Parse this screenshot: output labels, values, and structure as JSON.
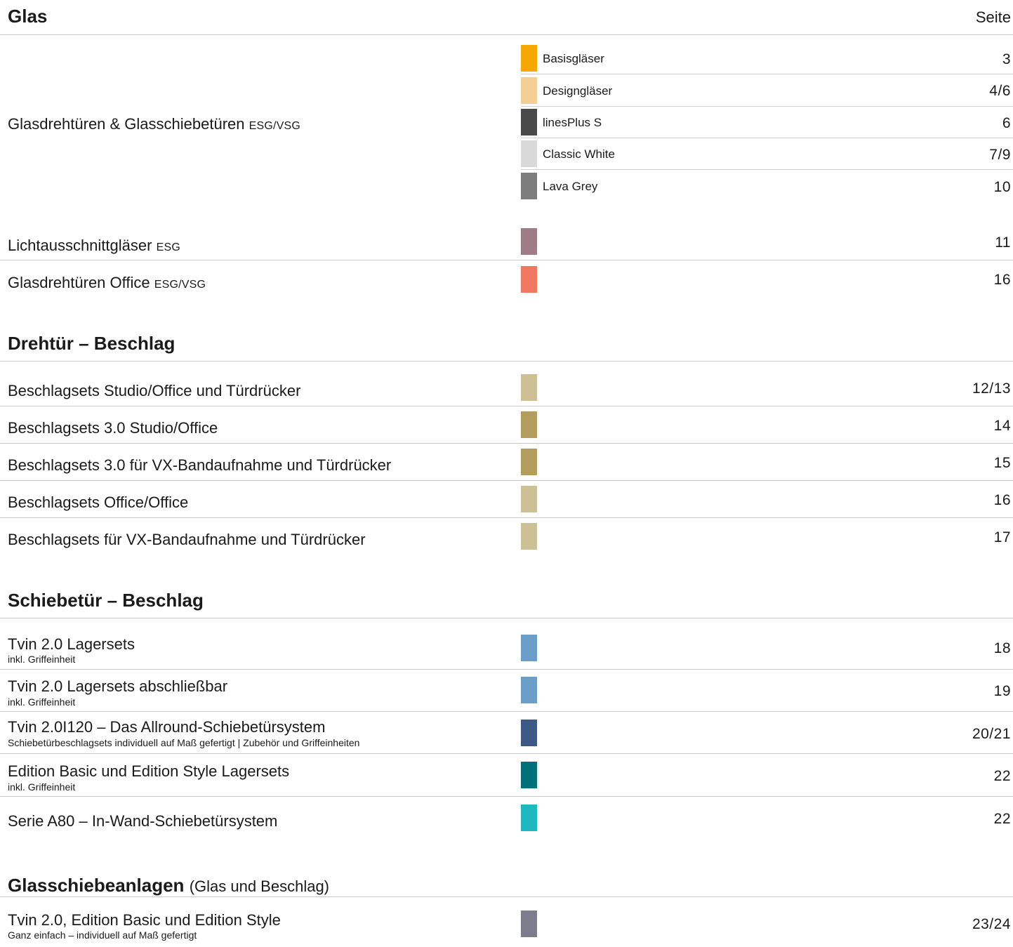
{
  "sections": [
    {
      "title": "Glas",
      "right_label": "Seite"
    },
    {
      "title": "Drehtür – Beschlag"
    },
    {
      "title": "Schiebetür – Beschlag"
    },
    {
      "title": "Glasschiebeanlagen",
      "note": "(Glas und Beschlag)"
    }
  ],
  "glas": {
    "group": {
      "title": "Glasdrehtüren & Glasschiebetüren",
      "suffix": "ESG/VSG",
      "items": [
        {
          "label": "Basisgläser",
          "page": "3",
          "color": "#f5a800"
        },
        {
          "label": "Designgläser",
          "page": "4/6",
          "color": "#f3cf96"
        },
        {
          "label": "linesPlus S",
          "page": "6",
          "color": "#4a4a4a"
        },
        {
          "label": "Classic White",
          "page": "7/9",
          "color": "#d9d9d9"
        },
        {
          "label": "Lava Grey",
          "page": "10",
          "color": "#7d7d7d"
        }
      ]
    },
    "rows": [
      {
        "title": "Lichtausschnittgläser",
        "suffix": "ESG",
        "page": "11",
        "color": "#9e7b85"
      },
      {
        "title": "Glasdrehtüren Office",
        "suffix": "ESG/VSG",
        "page": "16",
        "color": "#f07860"
      }
    ]
  },
  "drehtuer": {
    "rows": [
      {
        "title": "Beschlagsets Studio/Office und Türdrücker",
        "page": "12/13",
        "color": "#cdc095"
      },
      {
        "title": "Beschlagsets 3.0 Studio/Office",
        "page": "14",
        "color": "#b39c5c"
      },
      {
        "title": "Beschlagsets 3.0 für VX-Bandaufnahme und Türdrücker",
        "page": "15",
        "color": "#b39c5c"
      },
      {
        "title": "Beschlagsets Office/Office",
        "page": "16",
        "color": "#cdc095"
      },
      {
        "title": "Beschlagsets für VX-Bandaufnahme und Türdrücker",
        "page": "17",
        "color": "#cdc095"
      }
    ]
  },
  "schiebetuer": {
    "rows": [
      {
        "title": "Tvin 2.0 Lagersets",
        "sub": "inkl. Griffeinheit",
        "page": "18",
        "color": "#6a9ec8"
      },
      {
        "title": "Tvin 2.0 Lagersets abschließbar",
        "sub": "inkl. Griffeinheit",
        "page": "19",
        "color": "#6a9ec8"
      },
      {
        "title": "Tvin 2.0I120 – Das Allround-Schiebetürsystem",
        "sub": "Schiebetürbeschlagsets individuell auf Maß gefertigt | Zubehör und Griffeinheiten",
        "page": "20/21",
        "color": "#3c5a85"
      },
      {
        "title": "Edition Basic und Edition Style Lagersets",
        "sub": "inkl. Griffeinheit",
        "page": "22",
        "color": "#00707a"
      },
      {
        "title": "Serie A80 – In-Wand-Schiebetürsystem",
        "page": "22",
        "color": "#1fb8c0"
      }
    ]
  },
  "glasschiebe": {
    "rows": [
      {
        "title": "Tvin 2.0, Edition Basic und Edition Style",
        "sub": "Ganz einfach – individuell auf Maß gefertigt",
        "page": "23/24",
        "color": "#7c7c8e"
      }
    ]
  }
}
